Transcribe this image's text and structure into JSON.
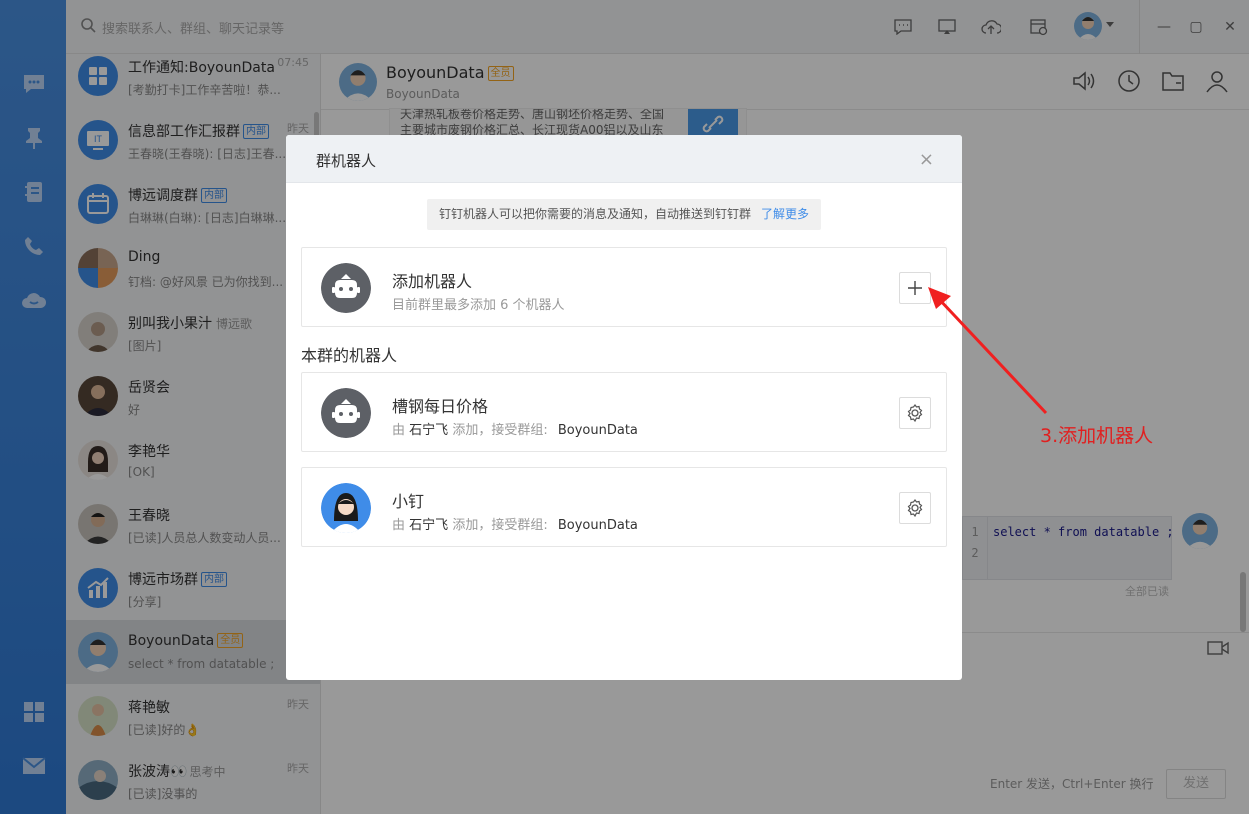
{
  "search": {
    "placeholder": "搜索联系人、群组、聊天记录等"
  },
  "conversations": [
    {
      "name": "工作通知:BoyounData",
      "tag": "",
      "preview": "[考勤打卡]工作辛苦啦！恭...",
      "time": "07:45"
    },
    {
      "name": "信息部工作汇报群",
      "tag": "内部",
      "preview": "王春晓(王春晓): [日志]王春...",
      "time": "昨天"
    },
    {
      "name": "博远调度群",
      "tag": "内部",
      "preview": "白琳琳(白琳): [日志]白琳琳...",
      "time": ""
    },
    {
      "name": "Ding",
      "tag": "",
      "preview": "钉档: @好风景  已为你找到...",
      "time": ""
    },
    {
      "name": "别叫我小果汁",
      "tag": "",
      "status": "博远歌",
      "preview": "[图片]",
      "time": ""
    },
    {
      "name": "岳贤会",
      "tag": "",
      "preview": "好",
      "time": ""
    },
    {
      "name": "李艳华",
      "tag": "",
      "preview": "[OK]",
      "time": ""
    },
    {
      "name": "王春晓",
      "tag": "",
      "preview": "[已读]人员总人数变动人员...",
      "time": ""
    },
    {
      "name": "博远市场群",
      "tag": "内部",
      "preview": "[分享]",
      "time": ""
    },
    {
      "name": "BoyounData",
      "tag": "全员",
      "preview": "select * from datatable ;",
      "time": ""
    },
    {
      "name": "蒋艳敏",
      "tag": "",
      "preview": "[已读]好的👌",
      "time": "昨天"
    },
    {
      "name": "张波涛👀",
      "tag": "",
      "status": "思考中",
      "preview": "[已读]没事的",
      "time": "昨天"
    }
  ],
  "chat": {
    "title": "BoyounData",
    "tag": "全员",
    "subtitle": "BoyounData",
    "link_text_1": "天津热轧板卷价格走势、唐山钢坯价格走势、全国",
    "link_text_2": "主要城市废钢价格汇总、长江现货A00铝以及山东",
    "code_line1_no": "1",
    "code_line1": "select * from datatable ;",
    "code_line2_no": "2",
    "read_status": "全部已读",
    "send_hint": "Enter 发送，Ctrl+Enter 换行",
    "send_label": "发送"
  },
  "modal": {
    "title": "群机器人",
    "close": "×",
    "notice": "钉钉机器人可以把你需要的消息及通知，自动推送到钉钉群",
    "notice_link": "了解更多",
    "add": {
      "title": "添加机器人",
      "sub": "目前群里最多添加 6 个机器人"
    },
    "section": "本群的机器人",
    "robots": [
      {
        "name": "槽钢每日价格",
        "by": "由",
        "owner": "石宁飞",
        "mid": "添加，接受群组:",
        "group": "BoyounData"
      },
      {
        "name": "小钉",
        "by": "由",
        "owner": "石宁飞",
        "mid": "添加，接受群组:",
        "group": "BoyounData"
      }
    ]
  },
  "annotation": "3.添加机器人"
}
